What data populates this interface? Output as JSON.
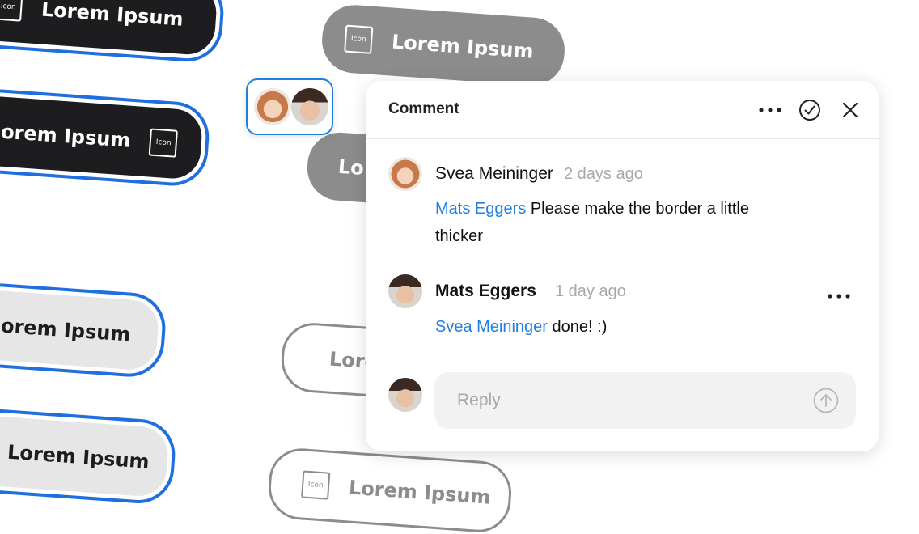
{
  "background_pills": {
    "dark_1": {
      "label": "Lorem Ipsum",
      "icon_text": "Icon"
    },
    "dark_2": {
      "label": "orem Ipsum",
      "icon_text": "Icon"
    },
    "grey_1": {
      "label": "Lorem Ipsum",
      "icon_text": "Icon"
    },
    "grey_2": {
      "label": "Lo"
    },
    "light_1": {
      "label": "orem Ipsum"
    },
    "light_2": {
      "label": "Lorem Ipsum"
    },
    "outline_1": {
      "label": "Lore"
    },
    "outline_2": {
      "label": "Lorem Ipsum",
      "icon_text": "Icon"
    }
  },
  "comment_panel": {
    "title": "Comment",
    "comments": [
      {
        "author": "Svea Meininger",
        "time": "2 days ago",
        "mention": "Mats Eggers",
        "text": " Please make the border a little thicker"
      },
      {
        "author": "Mats Eggers",
        "time": "1 day ago",
        "mention": "Svea Meininger",
        "text": " done! :)"
      }
    ],
    "reply_placeholder": "Reply"
  },
  "colors": {
    "accent": "#1f7fe5",
    "selection_border": "#1f6fde",
    "dark_pill": "#1d1d1f",
    "grey_pill": "#8c8c8c",
    "light_pill": "#e6e6e6"
  },
  "icons": [
    "more-icon",
    "check-circle-icon",
    "close-icon",
    "send-arrow-icon",
    "placeholder-icon"
  ]
}
